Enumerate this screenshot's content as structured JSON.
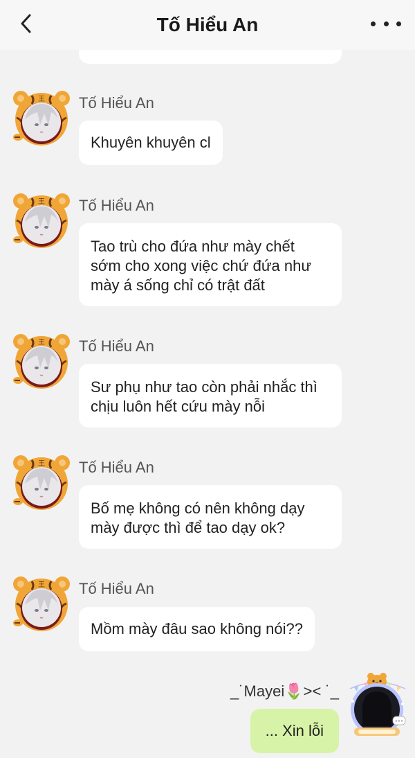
{
  "header": {
    "title": "Tố Hiểu An",
    "back_icon": "chevron-left-icon",
    "more_icon": "more-horizontal-icon"
  },
  "messages": [
    {
      "sender": "Tố Hiểu An",
      "text": "Khuyên khuyên cl"
    },
    {
      "sender": "Tố Hiểu An",
      "text": "Tao trù cho đứa như mày chết\nsớm cho xong việc chứ đứa như\nmày á sống chỉ có trật đất"
    },
    {
      "sender": "Tố Hiểu An",
      "text": "Sư phụ như tao còn phải nhắc thì\nchịu luôn hết cứu mày nỗi"
    },
    {
      "sender": "Tố Hiểu An",
      "text": "Bố mẹ không có nên không dạy\nmày được thì để tao dạy ok?"
    },
    {
      "sender": "Tố Hiểu An",
      "text": "Mồm mày đâu sao không nói??"
    }
  ],
  "me": {
    "name": "_˙Mayei🌷>< ˙_",
    "text": "... Xin lỗi"
  },
  "colors": {
    "background": "#f2f2f2",
    "bubble_incoming": "#ffffff",
    "bubble_outgoing": "#d7f3a7",
    "avatar_orange": "#f0a637"
  }
}
